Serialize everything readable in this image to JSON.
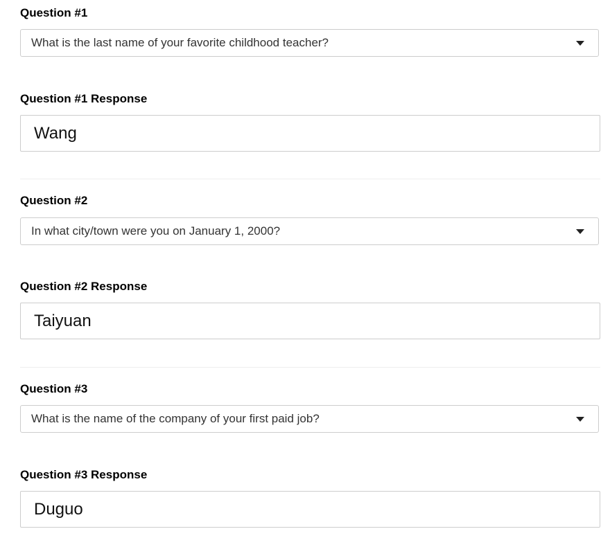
{
  "questions": [
    {
      "label": "Question #1",
      "selected": "What is the last name of your favorite childhood teacher?",
      "response_label": "Question #1 Response",
      "response": "Wang"
    },
    {
      "label": "Question #2",
      "selected": "In what city/town were you on January 1, 2000?",
      "response_label": "Question #2 Response",
      "response": "Taiyuan"
    },
    {
      "label": "Question #3",
      "selected": "What is the name of the company of your first paid job?",
      "response_label": "Question #3 Response",
      "response": "Duguo"
    }
  ],
  "icons": {
    "dropdown": "chevron-down-icon"
  },
  "colors": {
    "border": "#cccccc",
    "divider": "#eeeeee",
    "select_text": "#333333",
    "label_text": "#000000"
  }
}
